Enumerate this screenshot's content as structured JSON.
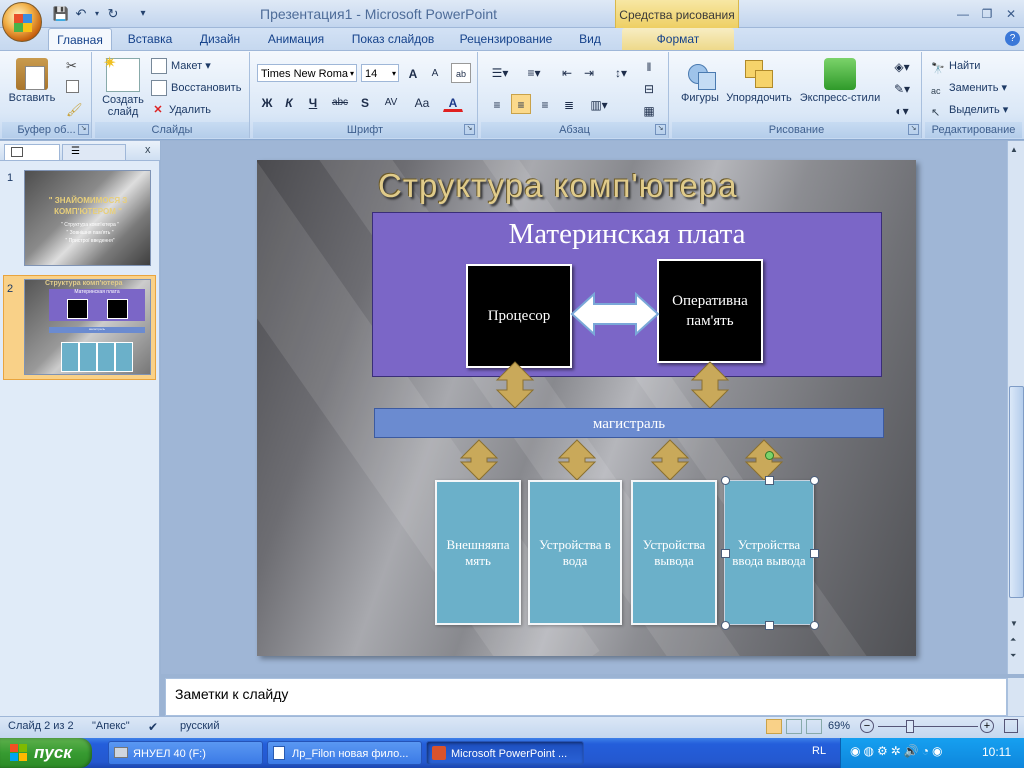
{
  "titlebar": {
    "window_title": "Презентация1 - Microsoft PowerPoint",
    "context_tab": "Средства рисования",
    "minimize": "—",
    "maximize": "❐",
    "close": "✕"
  },
  "tabs": [
    "Главная",
    "Вставка",
    "Дизайн",
    "Анимация",
    "Показ слайдов",
    "Рецензирование",
    "Вид",
    "Формат"
  ],
  "ribbon": {
    "clipboard": {
      "paste": "Вставить",
      "label": "Буфер об..."
    },
    "slides": {
      "new_slide_1": "Создать",
      "new_slide_2": "слайд",
      "layout": "Макет",
      "reset": "Восстановить",
      "delete": "Удалить",
      "label": "Слайды"
    },
    "font": {
      "font_name": "Times New Roma",
      "font_size": "14",
      "label": "Шрифт",
      "bold": "Ж",
      "italic": "К",
      "underline": "Ч",
      "strike": "abc",
      "shadow": "S",
      "spacing": "AV",
      "case": "Aa",
      "color": "A",
      "grow": "A",
      "shrink": "A"
    },
    "paragraph": {
      "label": "Абзац"
    },
    "drawing": {
      "shapes": "Фигуры",
      "arrange": "Упорядочить",
      "quick_styles": "Экспресс-стили",
      "label": "Рисование"
    },
    "editing": {
      "find": "Найти",
      "replace": "Заменить",
      "select": "Выделить",
      "label": "Редактирование"
    }
  },
  "slide_panel": {
    "thumb1": {
      "num": "1",
      "title": "\" ЗНАЙОМИМОСЯ  З КОМП'ЮТЕРОМ  \"",
      "lines": [
        "\" Структура комп'ютера \"",
        "\" Зовнішня пам'ять \"",
        "\" Пристрої введення\""
      ]
    },
    "thumb2": {
      "num": "2",
      "title": "Структура  комп'ютера",
      "board": "Материнская плата",
      "bus": "магистраль"
    }
  },
  "slide": {
    "title": "Структура комп'ютера",
    "motherboard": "Материнская плата",
    "cpu": "Процесор",
    "ram": "Оперативна пам'ять",
    "bus": "магистраль",
    "devices": [
      "Внешняяпа мять",
      "Устройства в вода",
      "Устройства вывода",
      "Устройства ввода вывода"
    ]
  },
  "notes_placeholder": "Заметки к слайду",
  "status": {
    "slide_info": "Слайд 2 из 2",
    "theme": "\"Апекс\"",
    "language": "русский",
    "zoom": "69%"
  },
  "taskbar": {
    "start": "пуск",
    "items": [
      "ЯНУЕЛ 40 (F:)",
      "Лр_Filon новая фило...",
      "Microsoft PowerPoint ..."
    ],
    "lang": "RL",
    "clock": "10:11"
  },
  "colors": {
    "motherboard": "#7b66c7",
    "bus": "#6b8bd0",
    "device": "#6bb0c9",
    "arrow": "#c9a95a",
    "title": "#e0cb8a"
  }
}
